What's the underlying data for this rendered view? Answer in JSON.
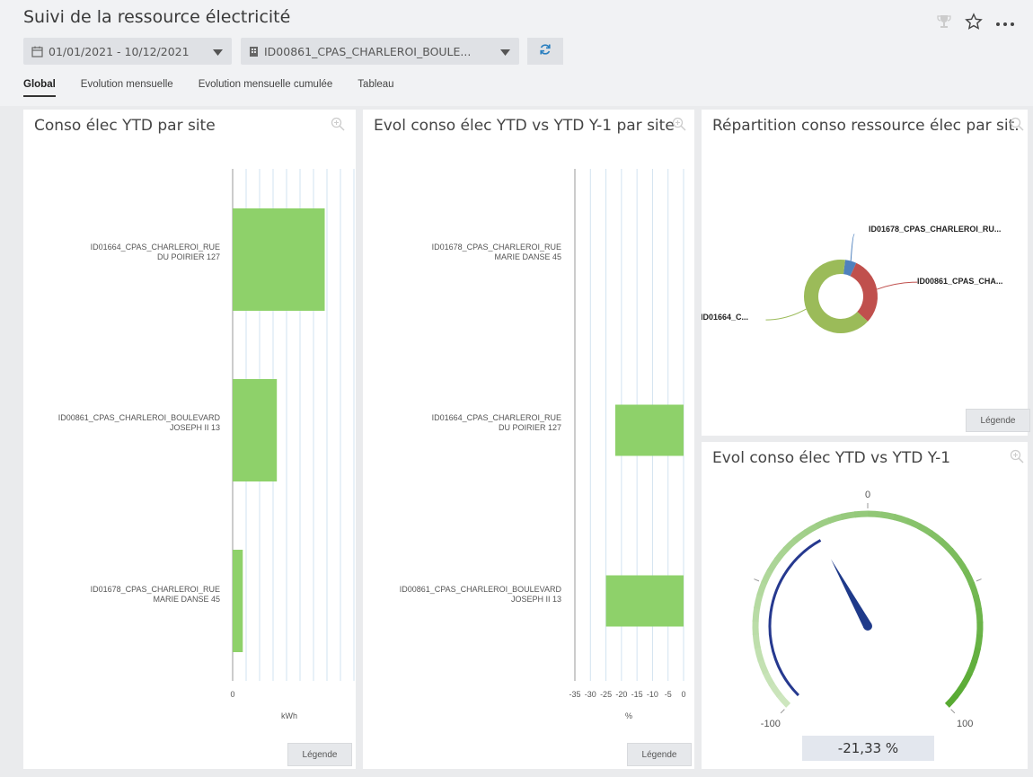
{
  "header": {
    "title": "Suivi de la ressource électricité",
    "date_filter": "01/01/2021 - 10/12/2021",
    "site_filter": "ID00861_CPAS_CHARLEROI_BOULE...",
    "icons": [
      "trophy-icon",
      "star-icon",
      "more-icon",
      "calendar-icon",
      "building-icon",
      "refresh-icon"
    ]
  },
  "tabs": [
    "Global",
    "Evolution mensuelle",
    "Evolution mensuelle cumulée",
    "Tableau"
  ],
  "active_tab": "Global",
  "legend_label": "Légende",
  "panels": {
    "conso": {
      "title": "Conso élec YTD par site",
      "categories": [
        [
          "ID01664_CPAS_CHARLEROI_RUE",
          "DU POIRIER 127"
        ],
        [
          "ID00861_CPAS_CHARLEROI_BOULEVARD",
          "JOSEPH II 13"
        ],
        [
          "ID01678_CPAS_CHARLEROI_RUE",
          "MARIE DANSE 45"
        ]
      ],
      "x_tick": "0",
      "x_unit": "kWh"
    },
    "evol": {
      "title": "Evol conso élec YTD vs YTD Y-1 par site",
      "categories": [
        [
          "ID01678_CPAS_CHARLEROI_RUE",
          "MARIE DANSE 45"
        ],
        [
          "ID01664_CPAS_CHARLEROI_RUE",
          "DU POIRIER 127"
        ],
        [
          "ID00861_CPAS_CHARLEROI_BOULEVARD",
          "JOSEPH II 13"
        ]
      ],
      "x_ticks": [
        "-35",
        "-30",
        "-25",
        "-20",
        "-15",
        "-10",
        "-5",
        "0"
      ],
      "x_unit": "%"
    },
    "repartition": {
      "title": "Répartition conso ressource élec par sit...",
      "labels": [
        "ID01678_CPAS_CHARLEROI_RU...",
        "ID00861_CPAS_CHA...",
        "ID01664_C..."
      ]
    },
    "gauge": {
      "title": "Evol conso élec YTD vs YTD Y-1",
      "min_label": "-100",
      "max_label": "100",
      "zero_label": "0",
      "value": -21.33,
      "value_label": "-21,33 %"
    }
  },
  "chart_data": [
    {
      "type": "bar",
      "title": "Conso élec YTD par site",
      "orientation": "horizontal",
      "categories": [
        "ID01664_CPAS_CHARLEROI_RUE DU POIRIER 127",
        "ID00861_CPAS_CHARLEROI_BOULEVARD JOSEPH II 13",
        "ID01678_CPAS_CHARLEROI_RUE MARIE DANSE 45"
      ],
      "values": [
        100,
        48,
        11
      ],
      "xlabel": "kWh",
      "grid": true,
      "color": "#8ed16a"
    },
    {
      "type": "bar",
      "title": "Evol conso élec YTD vs YTD Y-1 par site",
      "orientation": "horizontal",
      "categories": [
        "ID01678_CPAS_CHARLEROI_RUE MARIE DANSE 45",
        "ID01664_CPAS_CHARLEROI_RUE DU POIRIER 127",
        "ID00861_CPAS_CHARLEROI_BOULEVARD JOSEPH II 13"
      ],
      "values": [
        0,
        -22,
        -25
      ],
      "xlabel": "%",
      "xlim": [
        -35,
        0
      ],
      "grid": true,
      "color": "#8ed16a"
    },
    {
      "type": "pie",
      "title": "Répartition conso ressource élec par sit...",
      "donut": true,
      "labels": [
        "ID01678_CPAS_CHARLEROI_RU...",
        "ID00861_CPAS_CHA...",
        "ID01664_C..."
      ],
      "values": [
        5,
        30,
        65
      ],
      "colors": [
        "#4f81bd",
        "#c0504d",
        "#9bbb59"
      ]
    }
  ]
}
